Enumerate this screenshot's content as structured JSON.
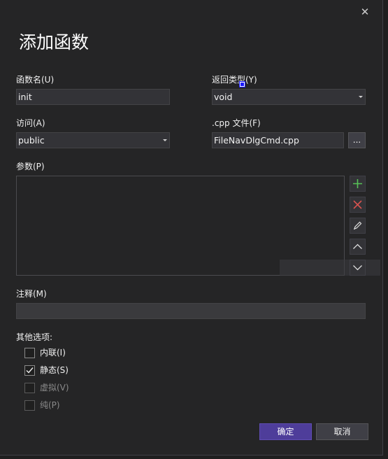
{
  "dialog": {
    "close_glyph": "✕",
    "title": "添加函数"
  },
  "function_name": {
    "label": "函数名(U)",
    "value": "init"
  },
  "return_type": {
    "label": "返回类型(Y)",
    "value": "void"
  },
  "access": {
    "label": "访问(A)",
    "value": "public"
  },
  "cpp_file": {
    "label": ".cpp 文件(F)",
    "value": "FileNavDlgCmd.cpp",
    "browse_label": "..."
  },
  "parameters": {
    "label": "参数(P)",
    "items": [],
    "buttons": [
      "plus-icon",
      "delete-x-icon",
      "pencil-icon",
      "chevron-up-icon",
      "chevron-down-icon"
    ]
  },
  "comment": {
    "label": "注释(M)",
    "value": ""
  },
  "options": {
    "label": "其他选项:",
    "items": [
      {
        "label": "内联(I)",
        "checked": false,
        "enabled": true
      },
      {
        "label": "静态(S)",
        "checked": true,
        "enabled": true
      },
      {
        "label": "虚拟(V)",
        "checked": false,
        "enabled": false
      },
      {
        "label": "纯(P)",
        "checked": false,
        "enabled": false
      }
    ]
  },
  "footer": {
    "ok_label": "确定",
    "cancel_label": "取消"
  },
  "colors": {
    "accent": "#4e3d9a",
    "add_icon": "#57c257",
    "delete_icon": "#d9534f",
    "background": "#252526"
  }
}
